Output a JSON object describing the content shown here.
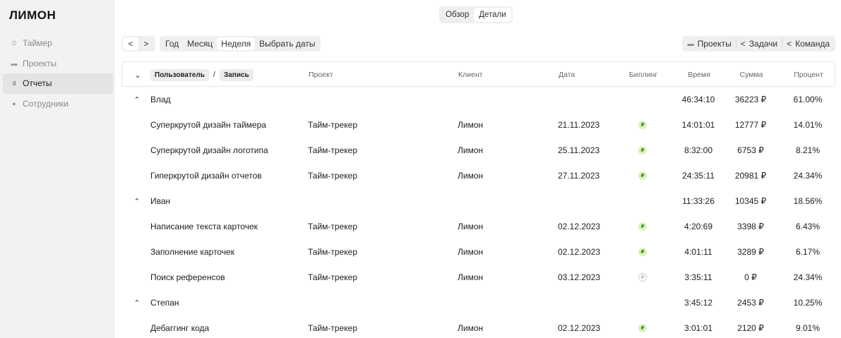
{
  "app": {
    "logo": "ЛИМОН"
  },
  "sidebar": {
    "items": [
      {
        "label": "Таймер",
        "icon": "stopwatch-icon",
        "glyph": "⏱",
        "active": false
      },
      {
        "label": "Проекты",
        "icon": "folder-icon",
        "glyph": "▬",
        "active": false
      },
      {
        "label": "Отчеты",
        "icon": "bar-chart-icon",
        "glyph": "ıl",
        "active": true
      },
      {
        "label": "Сотрудники",
        "icon": "person-icon",
        "glyph": "●",
        "active": false
      }
    ]
  },
  "view_switch": {
    "overview": "Обзор",
    "details": "Детали",
    "active": "details"
  },
  "toolbar": {
    "prev": "<",
    "next": ">",
    "periods": [
      "Год",
      "Месяц",
      "Неделя",
      "Выбрать даты"
    ],
    "active_period": "Неделя",
    "projects": "Проекты",
    "tasks": "Задачи",
    "team": "Команда"
  },
  "table": {
    "group_user": "Пользователь",
    "group_sep": "/",
    "group_record": "Запись",
    "columns": {
      "project": "Проект",
      "client": "Клиент",
      "date": "Дата",
      "billing": "Биллинг",
      "time": "Время",
      "sum": "Сумма",
      "percent": "Процент"
    },
    "rows": [
      {
        "type": "group",
        "name": "Влад",
        "time": "46:34:10",
        "sum": "36223 ₽",
        "percent": "61.00%"
      },
      {
        "type": "entry",
        "name": "Суперкрутой дизайн таймера",
        "project": "Тайм-трекер",
        "client": "Лимон",
        "date": "21.11.2023",
        "billable": true,
        "time": "14:01:01",
        "sum": "12777 ₽",
        "percent": "14.01%"
      },
      {
        "type": "entry",
        "name": "Суперкрутой дизайн логотипа",
        "project": "Тайм-трекер",
        "client": "Лимон",
        "date": "25.11.2023",
        "billable": true,
        "time": "8:32:00",
        "sum": "6753 ₽",
        "percent": "8.21%"
      },
      {
        "type": "entry",
        "name": "Гиперкрутой дизайн отчетов",
        "project": "Тайм-трекер",
        "client": "Лимон",
        "date": "27.11.2023",
        "billable": true,
        "time": "24:35:11",
        "sum": "20981 ₽",
        "percent": "24.34%"
      },
      {
        "type": "group",
        "name": "Иван",
        "time": "11:33:26",
        "sum": "10345 ₽",
        "percent": "18.56%"
      },
      {
        "type": "entry",
        "name": "Написание текста карточек",
        "project": "Тайм-трекер",
        "client": "Лимон",
        "date": "02.12.2023",
        "billable": true,
        "time": "4:20:69",
        "sum": "3398 ₽",
        "percent": "6.43%"
      },
      {
        "type": "entry",
        "name": "Заполнение карточек",
        "project": "Тайм-трекер",
        "client": "Лимон",
        "date": "02.12.2023",
        "billable": true,
        "time": "4:01:11",
        "sum": "3289 ₽",
        "percent": "6.17%"
      },
      {
        "type": "entry",
        "name": "Поиск референсов",
        "project": "Тайм-трекер",
        "client": "Лимон",
        "date": "03.12.2023",
        "billable": false,
        "time": "3:35:11",
        "sum": "0 ₽",
        "percent": "24.34%"
      },
      {
        "type": "group",
        "name": "Степан",
        "time": "3:45:12",
        "sum": "2453 ₽",
        "percent": "10.25%"
      },
      {
        "type": "entry",
        "name": "Дебаггинг кода",
        "project": "Тайм-трекер",
        "client": "Лимон",
        "date": "02.12.2023",
        "billable": true,
        "time": "3:01:01",
        "sum": "2120 ₽",
        "percent": "9.01%"
      }
    ]
  }
}
